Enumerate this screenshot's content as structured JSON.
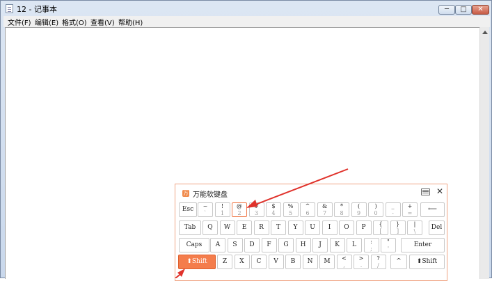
{
  "window": {
    "title": "12 - 记事本",
    "btn_min": "─",
    "btn_max": "□",
    "btn_close": "✕"
  },
  "menu": [
    "文件(F)",
    "编辑(E)",
    "格式(O)",
    "查看(V)",
    "帮助(H)"
  ],
  "keyboard": {
    "title": "万能软键盘",
    "logo": "万",
    "close": "✕",
    "row1": {
      "esc": "Esc",
      "backspace": "⟵",
      "keys": [
        {
          "top": "~",
          "bot": "`"
        },
        {
          "top": "!",
          "bot": "1"
        },
        {
          "top": "@",
          "bot": "2"
        },
        {
          "top": "#",
          "bot": "3"
        },
        {
          "top": "$",
          "bot": "4"
        },
        {
          "top": "%",
          "bot": "5"
        },
        {
          "top": "^",
          "bot": "6"
        },
        {
          "top": "&",
          "bot": "7"
        },
        {
          "top": "*",
          "bot": "8"
        },
        {
          "top": "(",
          "bot": "9"
        },
        {
          "top": ")",
          "bot": "0"
        },
        {
          "top": "_",
          "bot": "-"
        },
        {
          "top": "+",
          "bot": "="
        }
      ]
    },
    "row2": {
      "tab": "Tab",
      "del": "Del",
      "letters": [
        "Q",
        "W",
        "E",
        "R",
        "T",
        "Y",
        "U",
        "I",
        "O",
        "P"
      ],
      "extra": [
        {
          "top": "{",
          "bot": "["
        },
        {
          "top": "}",
          "bot": "]"
        },
        {
          "top": "|",
          "bot": "\\"
        }
      ]
    },
    "row3": {
      "caps": "Caps",
      "enter": "Enter",
      "letters": [
        "A",
        "S",
        "D",
        "F",
        "G",
        "H",
        "J",
        "K",
        "L"
      ],
      "extra": [
        {
          "top": ":",
          "bot": ";"
        },
        {
          "top": "\"",
          "bot": "'"
        }
      ]
    },
    "row4": {
      "shift_left": "⬆Shift",
      "shift_right": "⬆Shift",
      "up": "^",
      "letters": [
        "Z",
        "X",
        "C",
        "V",
        "B",
        "N",
        "M"
      ],
      "extra": [
        {
          "top": "<",
          "bot": ","
        },
        {
          "top": ">",
          "bot": "."
        },
        {
          "top": "?",
          "bot": "/"
        }
      ]
    },
    "accent_color": "#f47d4c"
  }
}
